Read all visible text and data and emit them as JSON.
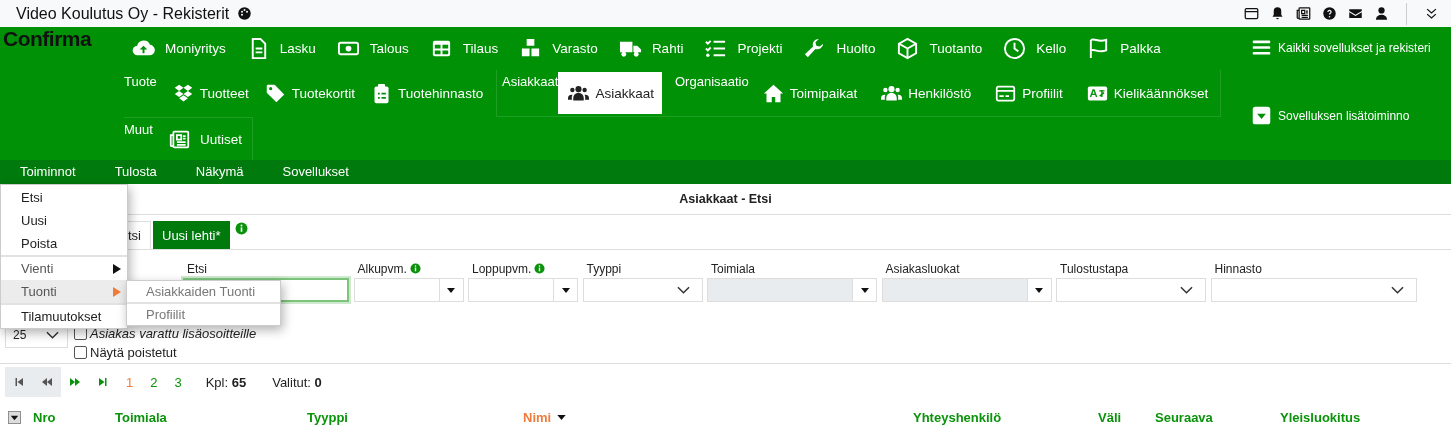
{
  "window": {
    "title": "Video Koulutus Oy - Rekisterit"
  },
  "logo": "Confirma",
  "apps": [
    {
      "label": "Moniyritys",
      "selected": false
    },
    {
      "label": "Lasku",
      "selected": false
    },
    {
      "label": "Talous",
      "selected": false
    },
    {
      "label": "Tilaus",
      "selected": false
    },
    {
      "label": "Varasto",
      "selected": false
    },
    {
      "label": "Rahti",
      "selected": false
    },
    {
      "label": "Projekti",
      "selected": false
    },
    {
      "label": "Huolto",
      "selected": false
    },
    {
      "label": "Tuotanto",
      "selected": false
    },
    {
      "label": "Kello",
      "selected": false
    },
    {
      "label": "Palkka",
      "selected": false
    }
  ],
  "app_group_rows": [
    {
      "groups": [
        {
          "label": "Tuote",
          "items": [
            {
              "label": "Tuotteet",
              "selected": false
            },
            {
              "label": "Tuotekortit",
              "selected": false
            },
            {
              "label": "Tuotehinnasto",
              "selected": false
            }
          ]
        },
        {
          "label": "Asiakkaat",
          "items": [
            {
              "label": "Asiakkaat",
              "selected": true
            }
          ]
        },
        {
          "label": "Organisaatio",
          "items": [
            {
              "label": "Toimipaikat",
              "selected": false
            },
            {
              "label": "Henkilöstö",
              "selected": false
            },
            {
              "label": "Profiilit",
              "selected": false
            },
            {
              "label": "Kielikäännökset",
              "selected": false
            }
          ]
        }
      ]
    },
    {
      "groups": [
        {
          "label": "Muut",
          "items": [
            {
              "label": "Uutiset",
              "selected": false
            }
          ]
        }
      ]
    }
  ],
  "all_apps": "Kaikki sovellukset ja rekisteri",
  "app_extras": "Sovelluksen lisätoiminno",
  "menubar": [
    {
      "label": "Toiminnot",
      "open": true
    },
    {
      "label": "Tulosta",
      "open": false
    },
    {
      "label": "Näkymä",
      "open": false
    },
    {
      "label": "Sovellukset",
      "open": false
    }
  ],
  "menu": [
    {
      "label": "Etsi",
      "kind": "item",
      "separator_above": false,
      "highlighted": false
    },
    {
      "label": "Uusi",
      "kind": "item",
      "separator_above": false,
      "highlighted": false
    },
    {
      "label": "Poista",
      "kind": "item",
      "separator_above": false,
      "highlighted": false
    },
    {
      "label": "Vienti",
      "kind": "submenu",
      "separator_above": true,
      "highlighted": false
    },
    {
      "label": "Tuonti",
      "kind": "submenu",
      "separator_above": false,
      "highlighted": true
    },
    {
      "label": "Tilamuutokset",
      "kind": "item",
      "separator_above": true,
      "highlighted": false
    }
  ],
  "submenu": [
    {
      "label": "Asiakkaiden Tuonti",
      "disabled": true
    },
    {
      "label": "Profiilit",
      "disabled": true
    }
  ],
  "page_title": "Asiakkaat - Etsi",
  "tabs": [
    {
      "label": "tsi",
      "selected": false
    },
    {
      "label": "Uusi lehti*",
      "selected": true
    }
  ],
  "filters": [
    {
      "label": "Etsi",
      "kind": "text",
      "info": false,
      "focused": true,
      "disabled": false
    },
    {
      "label": "Alkupvm.",
      "kind": "combo",
      "info": true,
      "focused": false,
      "disabled": false
    },
    {
      "label": "Loppupvm.",
      "kind": "combo",
      "info": true,
      "focused": false,
      "disabled": false
    },
    {
      "label": "Tyyppi",
      "kind": "select",
      "info": false,
      "focused": false,
      "disabled": false
    },
    {
      "label": "Toimiala",
      "kind": "combo",
      "info": false,
      "focused": false,
      "disabled": true
    },
    {
      "label": "Asiakasluokat",
      "kind": "combo",
      "info": false,
      "focused": false,
      "disabled": true
    },
    {
      "label": "Tulostustapa",
      "kind": "select",
      "info": false,
      "focused": false,
      "disabled": false
    },
    {
      "label": "Hinnasto",
      "kind": "select",
      "info": false,
      "focused": false,
      "disabled": false
    }
  ],
  "page_size": "25",
  "options": [
    {
      "label": "Asiakas varattu lisäosoitteille",
      "checked": false,
      "emphasized": true
    },
    {
      "label": "Näytä poistetut",
      "checked": false,
      "emphasized": false
    }
  ],
  "pager": {
    "nav": [
      {
        "disabled": true
      },
      {
        "disabled": true
      },
      {
        "disabled": false
      },
      {
        "disabled": false
      }
    ],
    "pages": [
      {
        "label": "1",
        "selected": true
      },
      {
        "label": "2",
        "selected": false
      },
      {
        "label": "3",
        "selected": false
      }
    ],
    "count": "Kpl: **65**",
    "selected_count": "Valitut: **0**"
  },
  "columns": [
    {
      "label": "Nro",
      "sorted": false
    },
    {
      "label": "Toimiala",
      "sorted": false
    },
    {
      "label": "Tyyppi",
      "sorted": false
    },
    {
      "label": "Nimi",
      "sorted": true
    },
    {
      "label": "Yhteyshenkilö",
      "sorted": false
    },
    {
      "label": "Väli",
      "sorted": false
    },
    {
      "label": "Seuraava",
      "sorted": false
    },
    {
      "label": "Yleisluokitus",
      "sorted": false
    }
  ]
}
